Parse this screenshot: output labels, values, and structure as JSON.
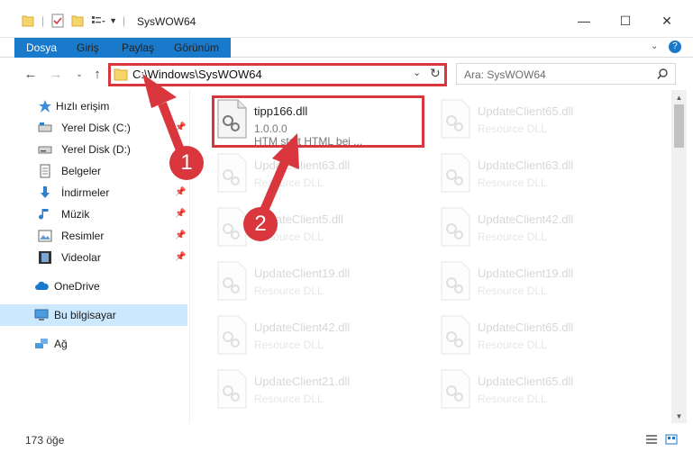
{
  "window": {
    "title": "SysWOW64",
    "minimize": "—",
    "maximize": "☐",
    "close": "✕"
  },
  "ribbon": {
    "tabs": [
      "Dosya",
      "Giriş",
      "Paylaş",
      "Görünüm"
    ]
  },
  "address": {
    "path": "C:\\Windows\\SysWOW64",
    "search_placeholder": "Ara: SysWOW64"
  },
  "sidebar": {
    "items": [
      {
        "label": "Hızlı erişim",
        "icon": "star-icon",
        "pinned": false
      },
      {
        "label": "Yerel Disk (C:)",
        "icon": "drive-icon",
        "pinned": true
      },
      {
        "label": "Yerel Disk (D:)",
        "icon": "drive-icon",
        "pinned": false
      },
      {
        "label": "Belgeler",
        "icon": "documents-icon",
        "pinned": true
      },
      {
        "label": "İndirmeler",
        "icon": "download-icon",
        "pinned": true
      },
      {
        "label": "Müzik",
        "icon": "music-icon",
        "pinned": true
      },
      {
        "label": "Resimler",
        "icon": "pictures-icon",
        "pinned": true
      },
      {
        "label": "Videolar",
        "icon": "videos-icon",
        "pinned": true
      },
      {
        "label": "OneDrive",
        "icon": "cloud-icon",
        "pinned": false
      },
      {
        "label": "Bu bilgisayar",
        "icon": "computer-icon",
        "pinned": false
      },
      {
        "label": "Ağ",
        "icon": "network-icon",
        "pinned": false
      }
    ]
  },
  "files": [
    {
      "name": "tipp166.dll",
      "sub1": "1.0.0.0",
      "sub2": "HTM statt HTML bei ..."
    },
    {
      "name": "UpdateClient65.dll",
      "sub1": "Resource DLL"
    },
    {
      "name": "UpdateClient63.dll",
      "sub1": "Resource DLL"
    },
    {
      "name": "UpdateClient63.dll",
      "sub1": "Resource DLL"
    },
    {
      "name": "UpdateClient5.dll",
      "sub1": "Resource DLL"
    },
    {
      "name": "UpdateClient42.dll",
      "sub1": "Resource DLL"
    },
    {
      "name": "UpdateClient19.dll",
      "sub1": "Resource DLL"
    },
    {
      "name": "UpdateClient19.dll",
      "sub1": "Resource DLL"
    },
    {
      "name": "UpdateClient42.dll",
      "sub1": "Resource DLL"
    },
    {
      "name": "UpdateClient65.dll",
      "sub1": "Resource DLL"
    },
    {
      "name": "UpdateClient21.dll",
      "sub1": "Resource DLL"
    },
    {
      "name": "UpdateClient65.dll",
      "sub1": "Resource DLL"
    }
  ],
  "status": {
    "count": "173 öğe"
  },
  "annotations": {
    "step1": "1",
    "step2": "2",
    "color": "#d9363e"
  },
  "colors": {
    "file_tab": "#1979ca",
    "selection": "#cce8ff"
  }
}
